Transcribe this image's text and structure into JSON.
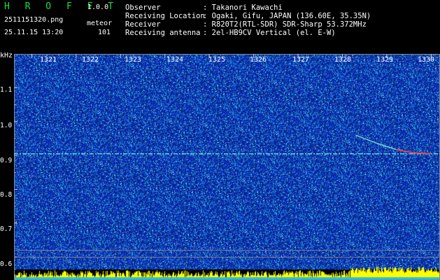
{
  "app": {
    "logo": "H R O F F T",
    "version": "1.0.0",
    "filename": "2511151320.png",
    "mode": "meteor",
    "datetime": "25.11.15 13:20",
    "count": "101"
  },
  "meta": {
    "rows": [
      {
        "label": "Observer",
        "value": ": Takanori Kawachi"
      },
      {
        "label": "Receiving Location",
        "value": ": Ogaki, Gifu, JAPAN (136.60E, 35.35N)"
      },
      {
        "label": "Receiver",
        "value": ": R820T2(RTL-SDR) SDR-Sharp 53.372MHz"
      },
      {
        "label": "Receiving antenna",
        "value": ": 2el-HB9CV Vertical (el. E-W)"
      }
    ]
  },
  "axis": {
    "y_unit": "kHz",
    "y_ticks": [
      "1.1",
      "1.0",
      "0.9",
      "0.8",
      "0.7",
      "0.6"
    ],
    "x_ticks": [
      "1321",
      "1322",
      "1323",
      "1324",
      "1325",
      "1326",
      "1327",
      "1328",
      "1329",
      "1330"
    ]
  },
  "colors": {
    "background": "#000000",
    "waterfall_base": "#0a1c8c",
    "logo": "#17e040",
    "carrier": "#6fe0e0",
    "trace": "#ff4040",
    "power": "#ffff00"
  },
  "chart_data": {
    "type": "heatmap",
    "ylabel": "kHz",
    "ylim": [
      0.58,
      1.2
    ],
    "xlim": [
      1320.6,
      1330.2
    ],
    "carrier_khz": 0.905,
    "meteor_trace": [
      {
        "x": 1328.3,
        "y": 0.96
      },
      {
        "x": 1328.8,
        "y": 0.935
      },
      {
        "x": 1329.2,
        "y": 0.918
      },
      {
        "x": 1329.6,
        "y": 0.908
      },
      {
        "x": 1330.0,
        "y": 0.905
      }
    ]
  }
}
